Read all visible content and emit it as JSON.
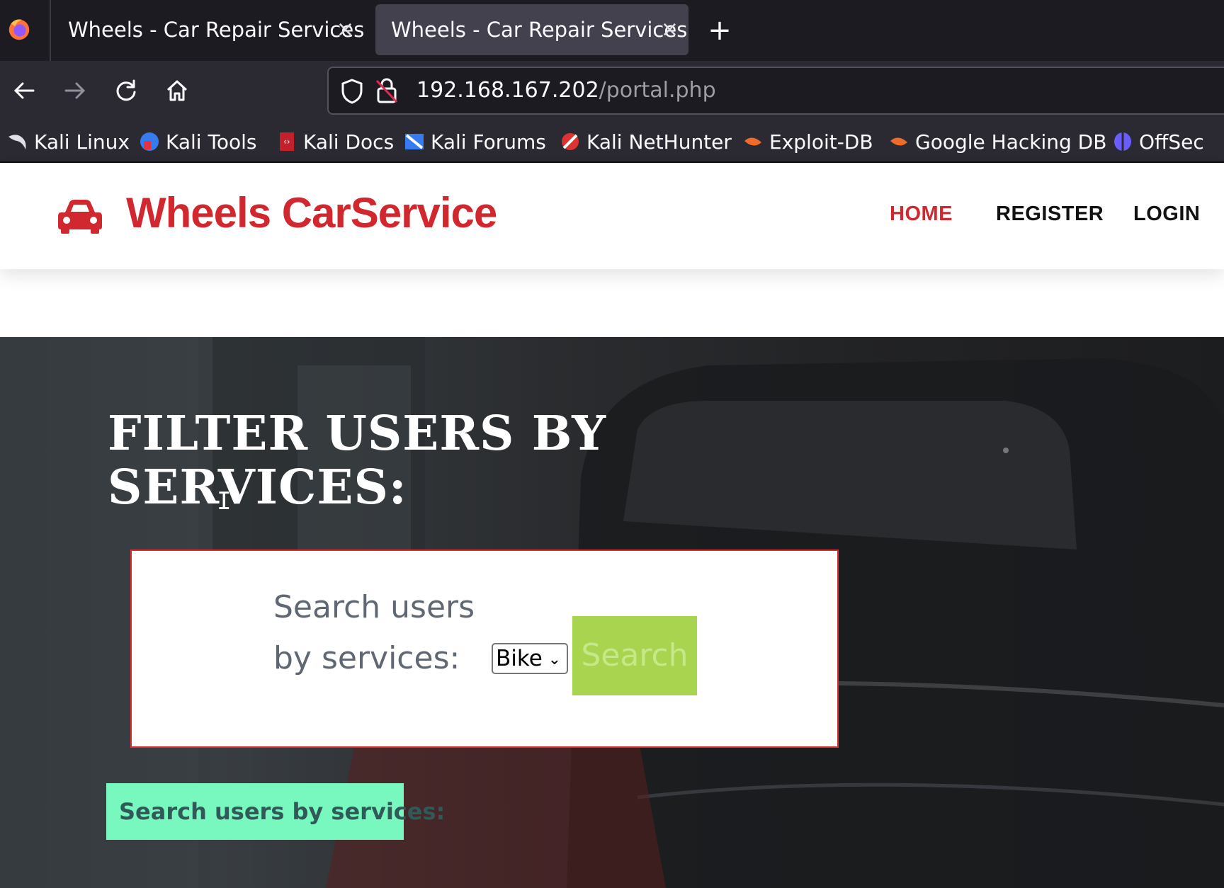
{
  "browser": {
    "tabs": [
      {
        "title": "Wheels - Car Repair Services"
      },
      {
        "title": "Wheels - Car Repair Services"
      }
    ],
    "new_tab_symbol": "+",
    "close_symbol": "×",
    "url_host": "192.168.167.202",
    "url_path": "/portal.php",
    "bookmarks": [
      {
        "label": "Kali Linux",
        "icon": "kali-dragon-icon"
      },
      {
        "label": "Kali Tools",
        "icon": "kali-tools-icon"
      },
      {
        "label": "Kali Docs",
        "icon": "kali-docs-icon"
      },
      {
        "label": "Kali Forums",
        "icon": "kali-forums-icon"
      },
      {
        "label": "Kali NetHunter",
        "icon": "kali-nethunter-icon"
      },
      {
        "label": "Exploit-DB",
        "icon": "exploit-db-icon"
      },
      {
        "label": "Google Hacking DB",
        "icon": "google-hacking-db-icon"
      },
      {
        "label": "OffSec",
        "icon": "offsec-icon"
      }
    ]
  },
  "site": {
    "brand": "Wheels CarService",
    "brand_icon": "car-icon",
    "nav": [
      {
        "label": "HOME",
        "active": true
      },
      {
        "label": "REGISTER",
        "active": false
      },
      {
        "label": "LOGIN",
        "active": false
      }
    ],
    "accent_color": "#d0282e"
  },
  "hero": {
    "title": "FILTER USERS BY SERVICES:",
    "search_label": "Search users by services:",
    "select_value": "Bike",
    "search_button": "Search",
    "result_label": "Search users by services:"
  }
}
